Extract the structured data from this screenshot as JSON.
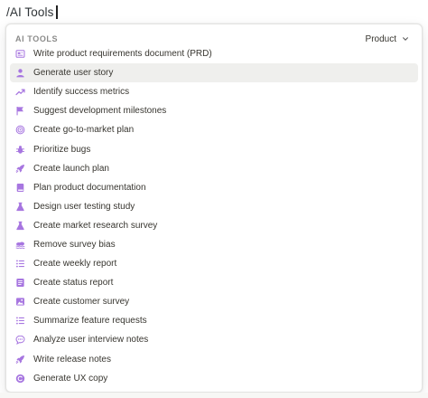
{
  "command": {
    "text": "/AI Tools"
  },
  "menu": {
    "section_label": "AI TOOLS",
    "filter": {
      "value": "Product"
    },
    "accent_color": "#a776e0",
    "selected_index": 1,
    "items": [
      {
        "label": "Write product requirements document (PRD)",
        "icon": "document-icon"
      },
      {
        "label": "Generate user story",
        "icon": "user-icon"
      },
      {
        "label": "Identify success metrics",
        "icon": "trend-up-icon"
      },
      {
        "label": "Suggest development milestones",
        "icon": "flag-icon"
      },
      {
        "label": "Create go-to-market plan",
        "icon": "target-icon"
      },
      {
        "label": "Prioritize bugs",
        "icon": "bug-icon"
      },
      {
        "label": "Create launch plan",
        "icon": "rocket-icon"
      },
      {
        "label": "Plan product documentation",
        "icon": "book-icon"
      },
      {
        "label": "Design user testing study",
        "icon": "flask-icon"
      },
      {
        "label": "Create market research survey",
        "icon": "flask-icon"
      },
      {
        "label": "Remove survey bias",
        "icon": "clouds-icon"
      },
      {
        "label": "Create weekly report",
        "icon": "list-icon"
      },
      {
        "label": "Create status report",
        "icon": "document-lines-icon"
      },
      {
        "label": "Create customer survey",
        "icon": "image-icon"
      },
      {
        "label": "Summarize feature requests",
        "icon": "list-icon"
      },
      {
        "label": "Analyze user interview notes",
        "icon": "chat-icon"
      },
      {
        "label": "Write release notes",
        "icon": "rocket-icon"
      },
      {
        "label": "Generate UX copy",
        "icon": "copy-circle-icon"
      }
    ]
  }
}
